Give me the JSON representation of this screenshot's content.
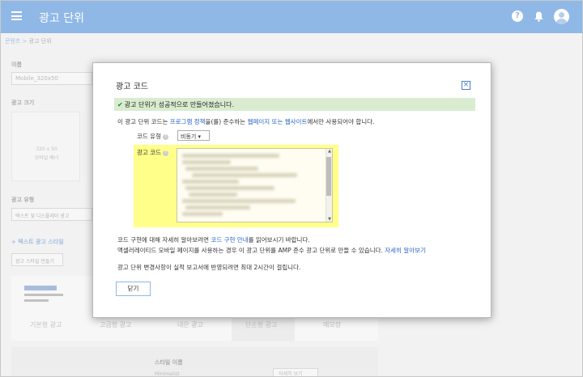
{
  "appbar": {
    "title": "광고 단위",
    "help_glyph": "?"
  },
  "background": {
    "breadcrumb_root": "콘텐츠",
    "breadcrumb_sep": " > ",
    "breadcrumb_current": "광고 단위",
    "name_label": "이름",
    "name_value": "Mobile_320x50",
    "size_label": "광고 크기",
    "preview_size": "320 x 50",
    "preview_name": "모바일 배너",
    "ad_type_label": "광고 유형",
    "ad_type_value": "텍스트 및 디스플레이 광고",
    "text_style_label": "+ 텍스트 광고 스타일",
    "style_button": "광고 스타일 만들기",
    "styles": [
      "기본형 광고",
      "고급형 광고",
      "내은 광고",
      "단순형 광고",
      "메모장"
    ],
    "style_name_label": "스타일 이름",
    "style_name_value": "Minimalist",
    "style_button2": "자세히 보기"
  },
  "dialog": {
    "title": "광고 코드",
    "close_glyph": "×",
    "success_message": "광고 단위가 성공적으로 만들어졌습니다.",
    "intro": {
      "pre": "이 광고 단위 코드는 ",
      "link1": "프로그램 정책",
      "mid": "을(를) 준수하는 ",
      "link2": "웹페이지 또는 웹사이트",
      "post": "에서만 사용되어야 합니다."
    },
    "code_type_label": "코드 유형",
    "code_type_value": "비동기 ▾",
    "code_label": "광고 코드",
    "info1": {
      "pre": "코드 구현에 대해 자세히 알아보려면 ",
      "link": "코드 구현 안내",
      "post": "를 읽어보시기 바랍니다."
    },
    "info2": {
      "pre": "액셀러레이티드 모바일 페이지를 사용하는 경우 이 광고 단위를 AMP 준수 광고 단위로 만들 수 있습니다. ",
      "link": "자세히 알아보기"
    },
    "info3": "광고 단위 변경사항이 실적 보고서에 반영되려면 최대 2시간이 걸립니다.",
    "close_button": "닫기"
  },
  "colors": {
    "appbar": "#8fb8e6",
    "success": "#d9ecd0",
    "code_highlight": "#ffff8a",
    "link": "#2a64c5"
  }
}
